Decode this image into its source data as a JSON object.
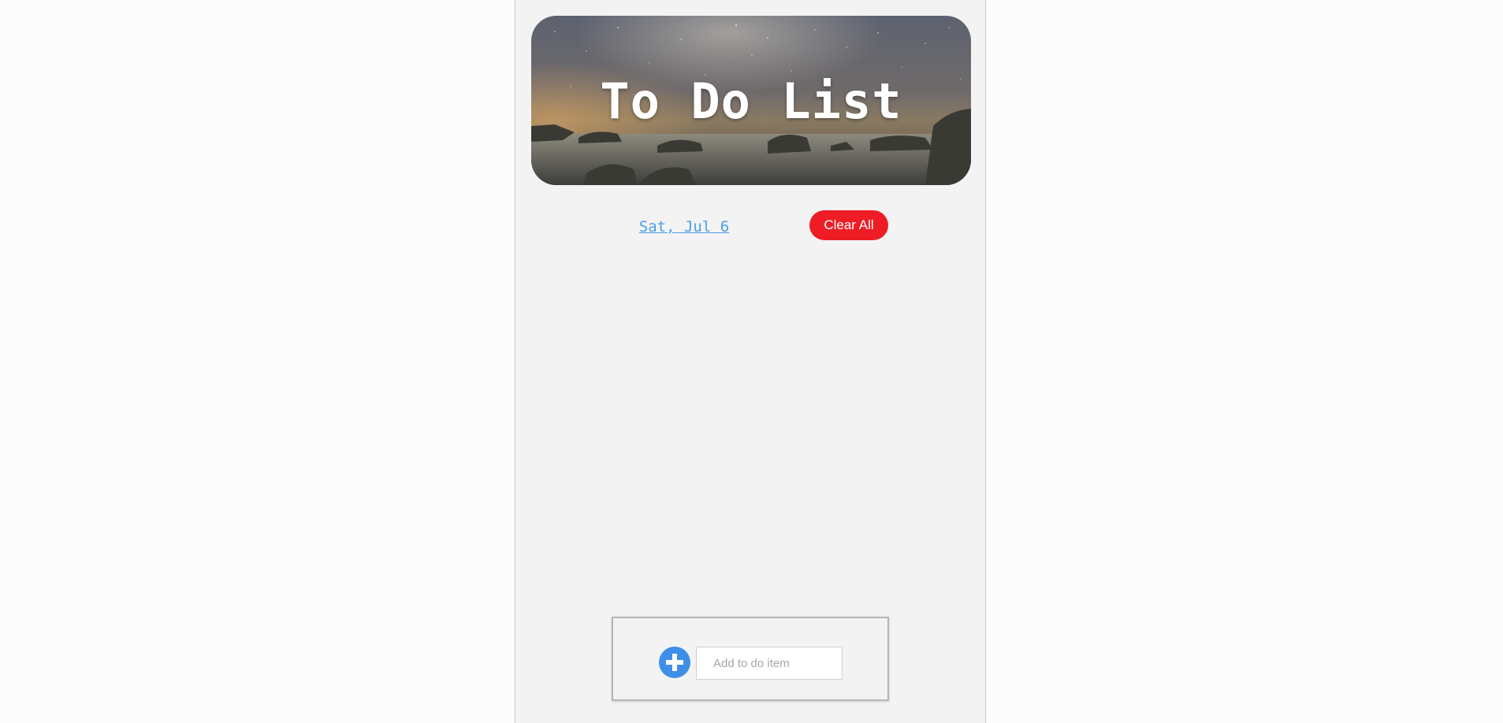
{
  "header": {
    "title": "To Do List"
  },
  "controls": {
    "date": "Sat, Jul 6",
    "clear_label": "Clear All"
  },
  "add_item": {
    "icon": "plus-icon",
    "input_value": "",
    "placeholder": "Add to do item"
  },
  "colors": {
    "accent": "#3f8fe8",
    "danger": "#ee1d25",
    "link": "#4a9fe8"
  }
}
